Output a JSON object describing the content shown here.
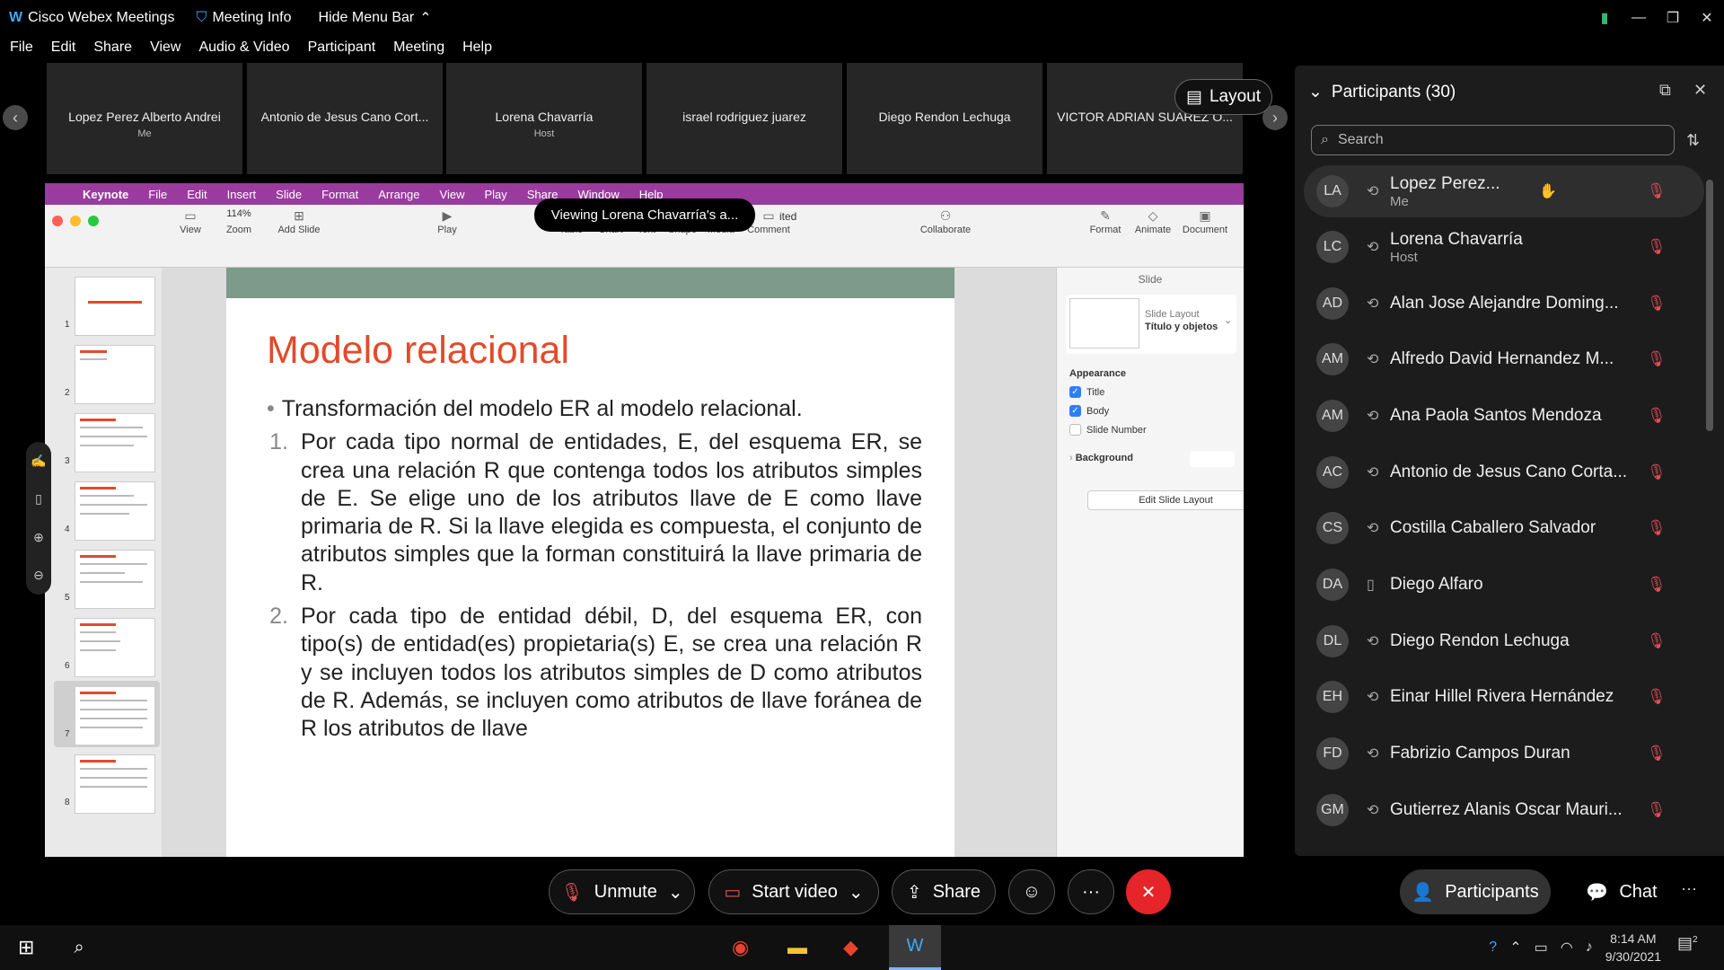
{
  "titlebar": {
    "app": "Cisco Webex Meetings",
    "meeting_info": "Meeting Info",
    "hide_menu": "Hide Menu Bar"
  },
  "menu": [
    "File",
    "Edit",
    "Share",
    "View",
    "Audio & Video",
    "Participant",
    "Meeting",
    "Help"
  ],
  "tiles": [
    {
      "name": "Lopez Perez Alberto Andrei",
      "sub": "Me"
    },
    {
      "name": "Antonio de Jesus Cano Cort...",
      "sub": ""
    },
    {
      "name": "Lorena Chavarría",
      "sub": "Host"
    },
    {
      "name": "israel rodriguez juarez",
      "sub": ""
    },
    {
      "name": "Diego Rendon Lechuga",
      "sub": ""
    },
    {
      "name": "VICTOR ADRIAN SUAREZ O...",
      "sub": ""
    }
  ],
  "layout_label": "Layout",
  "viewing_banner": "Viewing Lorena Chavarría's a...",
  "keynote": {
    "menu": [
      "Keynote",
      "File",
      "Edit",
      "Insert",
      "Slide",
      "Format",
      "Arrange",
      "View",
      "Play",
      "Share",
      "Window",
      "Help"
    ],
    "edited": "ited",
    "zoom": "114%",
    "toolbar": [
      "View",
      "Zoom",
      "Add Slide",
      "Play",
      "Table",
      "Chart",
      "Text",
      "Shape",
      "Media",
      "Comment",
      "Collaborate",
      "Format",
      "Animate",
      "Document"
    ],
    "slide_numbers": [
      "1",
      "2",
      "3",
      "4",
      "5",
      "6",
      "7",
      "8"
    ],
    "slide": {
      "title": "Modelo relacional",
      "bullet": "Transformación del modelo ER al modelo relacional.",
      "items": [
        {
          "n": "1.",
          "text": "Por cada tipo normal de entidades, E, del esquema ER, se crea una relación R que contenga todos los atributos simples de E. Se elige uno de los atributos llave de E como llave primaria de R. Si la llave elegida es compuesta, el conjunto de atributos simples que la forman constituirá la llave primaria de R."
        },
        {
          "n": "2.",
          "text": "Por cada tipo de entidad débil, D, del esquema ER, con tipo(s) de entidad(es) propietaria(s) E, se crea una relación R y se incluyen todos los atributos simples de D como atributos de R. Además, se incluyen como atributos de llave foránea de R los atributos de llave"
        }
      ]
    },
    "inspector": {
      "tab": "Slide",
      "layout_label": "Slide Layout",
      "layout_value": "Título y objetos",
      "appearance": "Appearance",
      "checks": [
        {
          "label": "Title",
          "checked": true
        },
        {
          "label": "Body",
          "checked": true
        },
        {
          "label": "Slide Number",
          "checked": false
        }
      ],
      "background": "Background",
      "edit_layout": "Edit Slide Layout"
    }
  },
  "participants": {
    "title": "Participants (30)",
    "search_placeholder": "Search",
    "list": [
      {
        "initials": "LA",
        "name": "Lopez Perez...",
        "sub": "Me",
        "audio": "sync"
      },
      {
        "initials": "LC",
        "name": "Lorena Chavarría",
        "sub": "Host",
        "audio": "sync"
      },
      {
        "initials": "AD",
        "name": "Alan Jose Alejandre Doming...",
        "sub": "",
        "audio": "sync"
      },
      {
        "initials": "AM",
        "name": "Alfredo David Hernandez M...",
        "sub": "",
        "audio": "sync"
      },
      {
        "initials": "AM",
        "name": "Ana Paola Santos Mendoza",
        "sub": "",
        "audio": "sync"
      },
      {
        "initials": "AC",
        "name": "Antonio de Jesus Cano Corta...",
        "sub": "",
        "audio": "sync"
      },
      {
        "initials": "CS",
        "name": "Costilla Caballero Salvador",
        "sub": "",
        "audio": "sync"
      },
      {
        "initials": "DA",
        "name": "Diego Alfaro",
        "sub": "",
        "audio": "phone"
      },
      {
        "initials": "DL",
        "name": "Diego Rendon Lechuga",
        "sub": "",
        "audio": "sync"
      },
      {
        "initials": "EH",
        "name": "Einar Hillel Rivera Hernández",
        "sub": "",
        "audio": "sync"
      },
      {
        "initials": "FD",
        "name": "Fabrizio Campos Duran",
        "sub": "",
        "audio": "sync"
      },
      {
        "initials": "GM",
        "name": "Gutierrez Alanis Oscar Mauri...",
        "sub": "",
        "audio": "sync"
      }
    ]
  },
  "controls": {
    "unmute": "Unmute",
    "start_video": "Start video",
    "share": "Share",
    "participants": "Participants",
    "chat": "Chat"
  },
  "taskbar": {
    "time": "8:14 AM",
    "date": "9/30/2021",
    "notif_count": "2"
  },
  "colors": {
    "end_call": "#e5252a",
    "mute_red": "#e0505a",
    "slide_title": "#e24a2b",
    "mac_menu": "#9b3a9f"
  }
}
